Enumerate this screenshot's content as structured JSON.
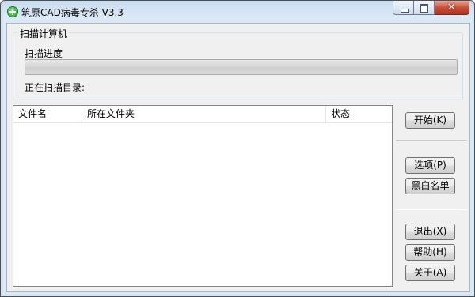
{
  "window": {
    "title": "筑原CAD病毒专杀  V3.3",
    "controls": {
      "close_glyph": "✕"
    }
  },
  "scan": {
    "group_title": "扫描计算机",
    "progress_label": "扫描进度",
    "progress_value": 0,
    "current_dir_label": "正在扫描目录:"
  },
  "results": {
    "columns": [
      "文件名",
      "所在文件夹",
      "状态"
    ],
    "rows": []
  },
  "actions": {
    "start": "开始(K)",
    "options": "选项(P)",
    "blackwhite_list": "黑白名单",
    "exit": "退出(X)",
    "help": "帮助(H)",
    "about": "关于(A)"
  }
}
